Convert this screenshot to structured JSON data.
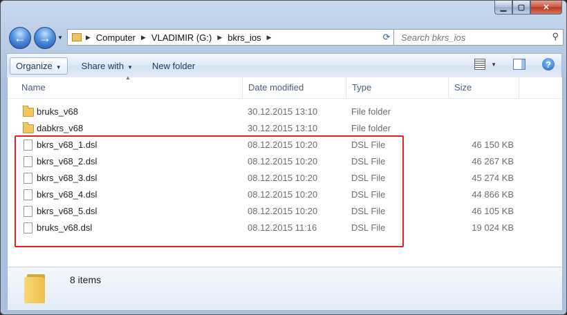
{
  "window": {
    "caption_buttons": {
      "minimize_icon": "minimize-icon",
      "maximize_icon": "maximize-icon",
      "close_icon": "close-icon"
    }
  },
  "nav": {
    "back_icon": "arrow-left-icon",
    "forward_icon": "arrow-right-icon",
    "breadcrumbs": [
      "Computer",
      "VLADIMIR (G:)",
      "bkrs_ios"
    ],
    "search_placeholder": "Search bkrs_ios"
  },
  "toolbar": {
    "organize_label": "Organize",
    "share_label": "Share with",
    "new_folder_label": "New folder"
  },
  "columns": {
    "name": "Name",
    "date": "Date modified",
    "type": "Type",
    "size": "Size"
  },
  "files": [
    {
      "name": "bruks_v68",
      "date": "30.12.2015 13:10",
      "type": "File folder",
      "size": "",
      "icon": "folder-icon"
    },
    {
      "name": "dabkrs_v68",
      "date": "30.12.2015 13:10",
      "type": "File folder",
      "size": "",
      "icon": "folder-icon"
    },
    {
      "name": "bkrs_v68_1.dsl",
      "date": "08.12.2015 10:20",
      "type": "DSL File",
      "size": "46 150 KB",
      "icon": "file-icon"
    },
    {
      "name": "bkrs_v68_2.dsl",
      "date": "08.12.2015 10:20",
      "type": "DSL File",
      "size": "46 267 KB",
      "icon": "file-icon"
    },
    {
      "name": "bkrs_v68_3.dsl",
      "date": "08.12.2015 10:20",
      "type": "DSL File",
      "size": "45 274 KB",
      "icon": "file-icon"
    },
    {
      "name": "bkrs_v68_4.dsl",
      "date": "08.12.2015 10:20",
      "type": "DSL File",
      "size": "44 866 KB",
      "icon": "file-icon"
    },
    {
      "name": "bkrs_v68_5.dsl",
      "date": "08.12.2015 10:20",
      "type": "DSL File",
      "size": "46 105 KB",
      "icon": "file-icon"
    },
    {
      "name": "bruks_v68.dsl",
      "date": "08.12.2015 11:16",
      "type": "DSL File",
      "size": "19 024 KB",
      "icon": "file-icon"
    }
  ],
  "status": {
    "items_count": "8 items"
  },
  "colors": {
    "highlight_border": "#e21f26",
    "toolbar_text": "#1e395b",
    "secondary_text": "#6d6d6d"
  }
}
